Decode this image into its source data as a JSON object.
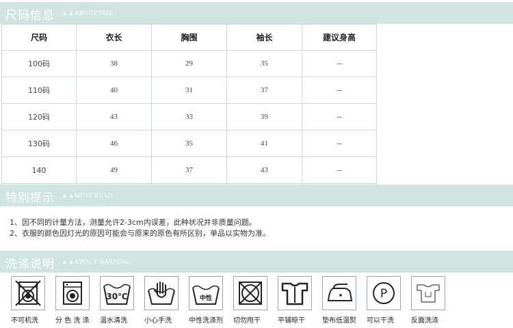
{
  "sections": {
    "size": {
      "title": "尺码信息",
      "subtitle": "▲▲ABOUT SIZE"
    },
    "tips": {
      "title": "特别提示",
      "subtitle": "▲▲MUST READ"
    },
    "wash": {
      "title": "洗涤说明",
      "subtitle": "▲▲ABOUT WASHING"
    }
  },
  "size_table": {
    "headers": [
      "尺码",
      "衣长",
      "胸围",
      "袖长",
      "建议身高"
    ],
    "rows": [
      [
        "100码",
        "38",
        "29",
        "35",
        "--"
      ],
      [
        "110码",
        "40",
        "31",
        "37",
        "--"
      ],
      [
        "120码",
        "43",
        "33",
        "39",
        "--"
      ],
      [
        "130码",
        "46",
        "35",
        "41",
        "--"
      ],
      [
        "140",
        "49",
        "37",
        "43",
        "--"
      ]
    ]
  },
  "tips": [
    "1、因不同的计量方法，测量允许2-3cm内误差，此种状况并非质量问题。",
    "2、衣服的颜色因灯光的原因可能会与原来的原色有所区别，单品以实物为准。"
  ],
  "wash_icons": [
    {
      "icon": "no-machine-wash-icon",
      "label": "不可机洗"
    },
    {
      "icon": "separate-color-wash-icon",
      "label": "分 色 洗 涤"
    },
    {
      "icon": "warm-water-wash-icon",
      "label": "温水清洗",
      "inner_text": "30℃"
    },
    {
      "icon": "hand-wash-icon",
      "label": "小心手洗"
    },
    {
      "icon": "neutral-detergent-icon",
      "label": "中性洗涤剂",
      "inner_text": "中性"
    },
    {
      "icon": "no-tumble-dry-icon",
      "label": "切勿甩干"
    },
    {
      "icon": "flat-dry-icon",
      "label": "平铺晾干"
    },
    {
      "icon": "low-temp-iron-icon",
      "label": "垫布低温熨"
    },
    {
      "icon": "dry-clean-icon",
      "label": "可以干洗",
      "inner_text": "P"
    },
    {
      "icon": "wash-inside-out-icon",
      "label": "反面洗涤"
    }
  ]
}
